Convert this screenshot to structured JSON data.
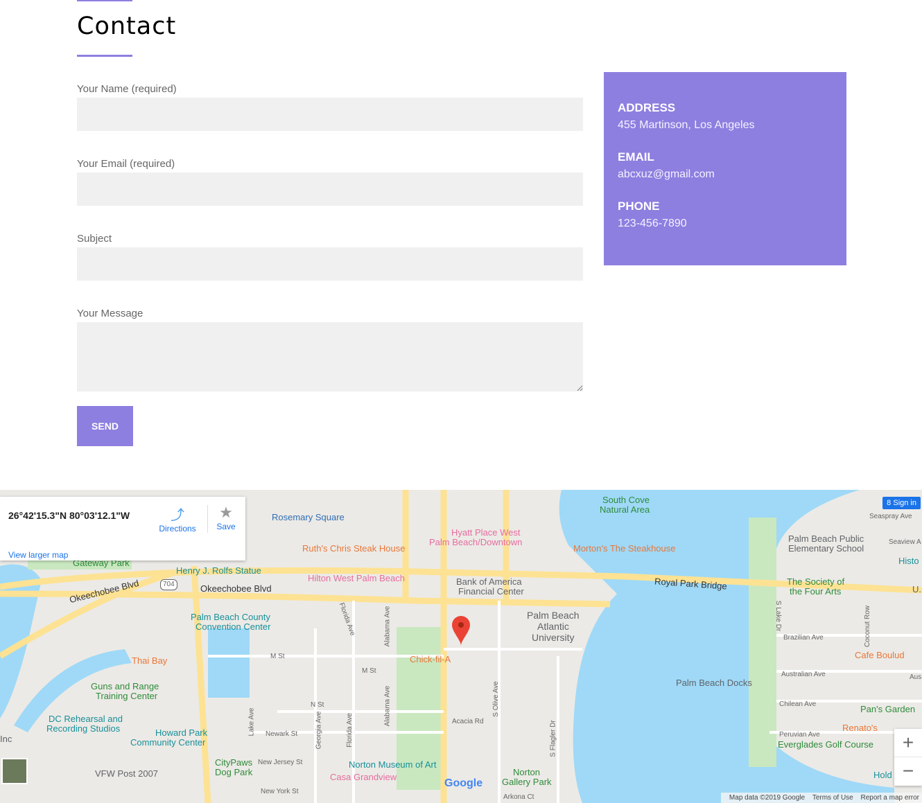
{
  "page": {
    "title": "Contact"
  },
  "form": {
    "name_label": "Your Name (required)",
    "email_label": "Your Email (required)",
    "subject_label": "Subject",
    "message_label": "Your Message",
    "name_value": "",
    "email_value": "",
    "subject_value": "",
    "message_value": "",
    "send_label": "SEND"
  },
  "info": {
    "address_heading": "ADDRESS",
    "address": "455 Martinson, Los Angeles",
    "email_heading": "EMAIL",
    "email": "abcxuz@gmail.com",
    "phone_heading": "PHONE",
    "phone": "123-456-7890"
  },
  "colors": {
    "accent": "#8d7fe0",
    "field": "#f0f0f0",
    "water": "#9fd9f7",
    "road": "#fde293"
  },
  "map": {
    "coords": "26°42'15.3\"N 80°03'12.1\"W",
    "directions": "Directions",
    "save": "Save",
    "view_larger": "View larger map",
    "sign_in": "Sign in",
    "zoom_in": "+",
    "zoom_out": "−",
    "google": "Google",
    "attribution": [
      "Map data ©2019 Google",
      "Terms of Use",
      "Report a map error"
    ],
    "shield": "704",
    "labels": [
      "Rosemary Square",
      "Ruth's Chris Steak House",
      "Hyatt Place West",
      "Palm Beach/Downtown",
      "Morton's The Steakhouse",
      "South Cove",
      "Natural Area",
      "Palm Beach Public",
      "Elementary School",
      "Seaspray Ave",
      "Seaview A",
      "Histo",
      "The Society of",
      "the Four Arts",
      "Gateway Park",
      "Henry J. Rolfs Statue",
      "Hilton West Palm Beach",
      "Bank of America",
      "Financial Center",
      "Royal Park Bridge",
      "Okeechobee Blvd",
      "Okeechobee Blvd",
      "Palm Beach County",
      "Convention Center",
      "Palm Beach",
      "Atlantic",
      "University",
      "Thai Bay",
      "Chick-fil-A",
      "M St",
      "M St",
      "Brazilian Ave",
      "Cafe Boulud",
      "Australian Ave",
      "Palm Beach Docks",
      "Guns and Range",
      "Training Center",
      "DC Rehearsal and",
      "Recording Studios",
      "Chilean Ave",
      "Pan's Garden",
      "N St",
      "Acacia Rd",
      "Renato's",
      "Peruvian Ave",
      "Everglades Golf Course",
      "Howard Park",
      "Community Center",
      "Inc",
      "Newark St",
      "CityPaws",
      "Dog Park",
      "New Jersey St",
      "Norton Museum of Art",
      "Casa Grandview",
      "VFW Post 2007",
      "Norton",
      "Gallery Park",
      "New York St",
      "Arkona Ct",
      "Hold",
      "Florida Ave",
      "Alabama Ave",
      "S Olive Ave",
      "S Flagler Dr",
      "Lake Ave",
      "Georgia Ave",
      "Florida Ave",
      "Alabama Ave",
      "S Lake Dr",
      "Coconut Row",
      "U.",
      "Aus"
    ]
  }
}
